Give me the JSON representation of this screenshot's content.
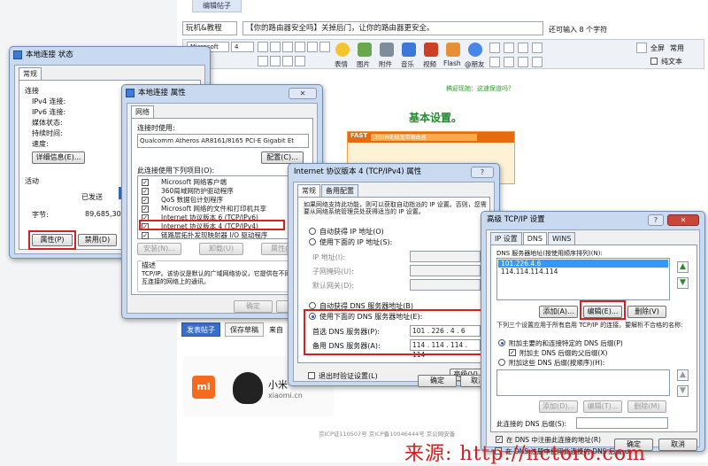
{
  "forum": {
    "tab_label": "编辑帖子",
    "category_select": "玩机&教程",
    "title_value": "【你的路由器安全吗】关掉后门，让你的路由器更安全。",
    "char_hint": "还可输入 8 个字符",
    "font_select": "Microsoft",
    "size_select": "4",
    "toolbar_labels": [
      "表情",
      "图片",
      "附件",
      "音乐",
      "视频",
      "Flash",
      "@朋友"
    ],
    "right_links": [
      "全屏",
      "常用"
    ],
    "plain_text_label": "纯文本",
    "green_small_text": "稿迎现她：这速保道吗？",
    "green_title": "基本设置。",
    "router_logo": "FAST",
    "router_tab_text": "300M无线宽带路由器",
    "publish_button": "发表帖子",
    "draft_button": "保存草稿",
    "from_text": "来自",
    "ad_brand": "小米",
    "ad_domain": "xiaomi.cn",
    "ad_logo": "mi",
    "footer_text": "京ICP证110507号 京ICP备10046444号 京公网安备",
    "watermark": "来源: http://nctoro.com"
  },
  "status_win": {
    "title": "本地连接 状态",
    "tab": "常规",
    "connection_label": "连接",
    "ipv4_label": "IPv4 连接:",
    "ipv6_label": "IPv6 连接:",
    "media_label": "媒体状态:",
    "duration_label": "持续时间:",
    "speed_label": "速度:",
    "details_button": "详细信息(E)...",
    "activity_label": "活动",
    "sent_label": "已发送",
    "bytes_label": "字节:",
    "bytes_value": "89,685,309",
    "properties_button": "属性(P)",
    "disable_button": "禁用(D)"
  },
  "props_win": {
    "title": "本地连接 属性",
    "tab": "网络",
    "connect_using_label": "连接时使用:",
    "adapter": "Qualcomm Atheros AR8161/8165 PCI-E Gigabit Et",
    "configure_button": "配置(C)...",
    "items_label": "此连接使用下列项目(O):",
    "items": [
      "Microsoft 网络客户端",
      "360局域网防护驱动程序",
      "QoS 数据包计划程序",
      "Microsoft 网络的文件和打印机共享",
      "Internet 协议版本 6 (TCP/IPv6)",
      "Internet 协议版本 4 (TCP/IPv4)",
      "链路层拓扑发现映射器 I/O 驱动程序"
    ],
    "install_button": "安装(N)...",
    "uninstall_button": "卸载(U)",
    "properties_button": "属性(R)",
    "description_label": "描述",
    "description_text": "TCP/IP。该协议是默认的广域网络协议，它提供在不同的相互连接的网络上的通讯。",
    "ok_button": "确定",
    "cancel_button": "取消"
  },
  "ipv4_win": {
    "title": "Internet 协议版本 4 (TCP/IPv4) 属性",
    "tabs": [
      "常规",
      "备用配置"
    ],
    "intro": "如果网络支持此功能，则可以获取自动指派的 IP 设置。否则，您需要从网络系统管理员处获得适当的 IP 设置。",
    "auto_ip": "自动获得 IP 地址(O)",
    "manual_ip": "使用下面的 IP 地址(S):",
    "ip_label": "IP 地址(I):",
    "mask_label": "子网掩码(U):",
    "gateway_label": "默认网关(D):",
    "auto_dns": "自动获得 DNS 服务器地址(B)",
    "manual_dns": "使用下面的 DNS 服务器地址(E):",
    "preferred_dns_label": "首选 DNS 服务器(P):",
    "preferred_dns_value": "101 . 226 .  4  .  6",
    "alternate_dns_label": "备用 DNS 服务器(A):",
    "alternate_dns_value": "114 . 114 . 114 . 114",
    "validate_label": "退出时验证设置(L)",
    "advanced_button": "高级(V)...",
    "ok_button": "确定",
    "cancel_button": "取消"
  },
  "adv_win": {
    "title": "高级 TCP/IP 设置",
    "tabs": [
      "IP 设置",
      "DNS",
      "WINS"
    ],
    "dns_list_label": "DNS 服务器地址(按使用顺序排列)(N):",
    "dns_list": [
      "101.226.4.6",
      "114.114.114.114"
    ],
    "add_button": "添加(A)...",
    "edit_button": "编辑(E)...",
    "remove_button": "删除(V)",
    "resolution_label": "下列三个设置应用于所有启用 TCP/IP 的连接。要解析不合格的名称:",
    "append_primary": "附加主要的和连接特定的 DNS 后缀(P)",
    "append_parent": "附加主 DNS 后缀的父后缀(X)",
    "append_these": "附加这些 DNS 后缀(按顺序)(H):",
    "add2_button": "添加(D)...",
    "edit2_button": "编辑(T)...",
    "remove2_button": "删除(M)",
    "suffix_label": "此连接的 DNS 后缀(S):",
    "register_label": "在 DNS 中注册此连接的地址(R)",
    "use_suffix_label": "在 DNS 注册中使用此连接的 DNS 后缀(U)",
    "ok_button": "确定",
    "cancel_button": "取消"
  },
  "colors": {
    "highlight_red": "#d42222",
    "selection_blue": "#3399ff",
    "green_title": "#1e8b2e"
  }
}
